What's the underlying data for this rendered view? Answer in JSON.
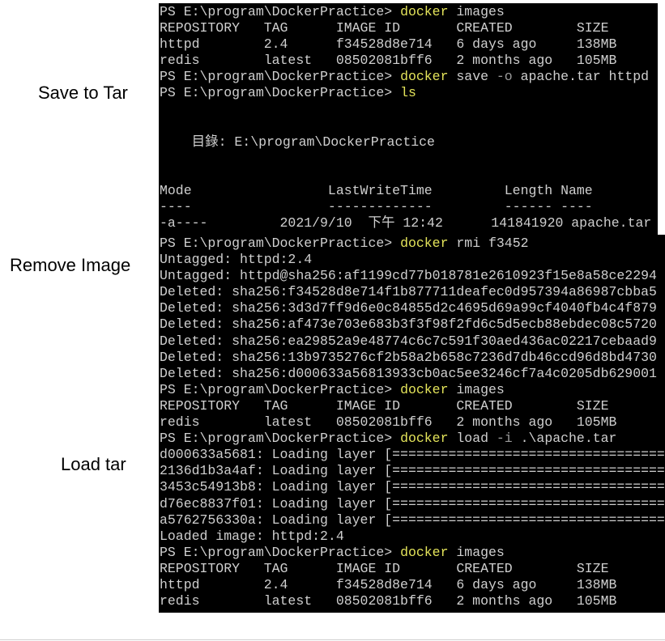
{
  "labels": {
    "save": "Save to Tar",
    "remove": "Remove Image",
    "load": "Load tar"
  },
  "colors": {
    "terminal_bg": "#000000",
    "text": "#cfcfcf",
    "command": "#e3e35a",
    "flag": "#9a9a9a"
  },
  "terminal1": {
    "lines": [
      {
        "segs": [
          {
            "t": "PS E:\\program\\DockerPractice> ",
            "c": "text"
          },
          {
            "t": "docker",
            "c": "cmd"
          },
          {
            "t": " images",
            "c": "text"
          }
        ]
      },
      {
        "segs": [
          {
            "t": "REPOSITORY   TAG      IMAGE ID       CREATED        SIZE",
            "c": "text"
          }
        ]
      },
      {
        "segs": [
          {
            "t": "httpd        2.4      f34528d8e714   6 days ago     138MB",
            "c": "text"
          }
        ]
      },
      {
        "segs": [
          {
            "t": "redis        latest   08502081bff6   2 months ago   105MB",
            "c": "text"
          }
        ]
      },
      {
        "segs": [
          {
            "t": "PS E:\\program\\DockerPractice> ",
            "c": "text"
          },
          {
            "t": "docker",
            "c": "cmd"
          },
          {
            "t": " save ",
            "c": "text"
          },
          {
            "t": "-o",
            "c": "flag"
          },
          {
            "t": " apache.tar httpd",
            "c": "text"
          }
        ]
      },
      {
        "segs": [
          {
            "t": "PS E:\\program\\DockerPractice> ",
            "c": "text"
          },
          {
            "t": "ls",
            "c": "cmd"
          }
        ]
      },
      {
        "segs": [
          {
            "t": "",
            "c": "text"
          }
        ]
      },
      {
        "segs": [
          {
            "t": "",
            "c": "text"
          }
        ]
      },
      {
        "segs": [
          {
            "t": "    目錄: E:\\program\\DockerPractice",
            "c": "text"
          }
        ]
      },
      {
        "segs": [
          {
            "t": "",
            "c": "text"
          }
        ]
      },
      {
        "segs": [
          {
            "t": "",
            "c": "text"
          }
        ]
      },
      {
        "segs": [
          {
            "t": "Mode                 LastWriteTime         Length Name",
            "c": "text"
          }
        ]
      },
      {
        "segs": [
          {
            "t": "----                 -------------         ------ ----",
            "c": "text"
          }
        ]
      },
      {
        "segs": [
          {
            "t": "-a----         2021/9/10  下午 12:42      141841920 apache.tar",
            "c": "text"
          }
        ]
      }
    ]
  },
  "terminal2": {
    "lines": [
      {
        "segs": [
          {
            "t": "PS E:\\program\\DockerPractice> ",
            "c": "text"
          },
          {
            "t": "docker",
            "c": "cmd"
          },
          {
            "t": " rmi f3452",
            "c": "text"
          }
        ]
      },
      {
        "segs": [
          {
            "t": "Untagged: httpd:2.4",
            "c": "text"
          }
        ]
      },
      {
        "segs": [
          {
            "t": "Untagged: httpd@sha256:af1199cd77b018781e2610923f15e8a58ce2294",
            "c": "text"
          }
        ]
      },
      {
        "segs": [
          {
            "t": "Deleted: sha256:f34528d8e714f1b877711deafec0d957394a86987cbba5",
            "c": "text"
          }
        ]
      },
      {
        "segs": [
          {
            "t": "Deleted: sha256:3d3d7ff9d6e0c84855d2c4695d69a99cf4040fb4c4f879",
            "c": "text"
          }
        ]
      },
      {
        "segs": [
          {
            "t": "Deleted: sha256:af473e703e683b3f3f98f2fd6c5d5ecb88ebdec08c5720",
            "c": "text"
          }
        ]
      },
      {
        "segs": [
          {
            "t": "Deleted: sha256:ea29852a9e48774c6c7c591f30aed436ac02217cebaad9",
            "c": "text"
          }
        ]
      },
      {
        "segs": [
          {
            "t": "Deleted: sha256:13b9735276cf2b58a2b658c7236d7db46ccd96d8bd4730",
            "c": "text"
          }
        ]
      },
      {
        "segs": [
          {
            "t": "Deleted: sha256:d000633a56813933cb0ac5ee3246cf7a4c0205db629001",
            "c": "text"
          }
        ]
      },
      {
        "segs": [
          {
            "t": "PS E:\\program\\DockerPractice> ",
            "c": "text"
          },
          {
            "t": "docker",
            "c": "cmd"
          },
          {
            "t": " images",
            "c": "text"
          }
        ]
      },
      {
        "segs": [
          {
            "t": "REPOSITORY   TAG      IMAGE ID       CREATED        SIZE",
            "c": "text"
          }
        ]
      },
      {
        "segs": [
          {
            "t": "redis        latest   08502081bff6   2 months ago   105MB",
            "c": "text"
          }
        ]
      },
      {
        "segs": [
          {
            "t": "PS E:\\program\\DockerPractice> ",
            "c": "text"
          },
          {
            "t": "docker",
            "c": "cmd"
          },
          {
            "t": " load ",
            "c": "text"
          },
          {
            "t": "-i",
            "c": "flag"
          },
          {
            "t": " .\\apache.tar",
            "c": "text"
          }
        ]
      },
      {
        "segs": [
          {
            "t": "d000633a5681: Loading layer [==================================",
            "c": "text"
          }
        ]
      },
      {
        "segs": [
          {
            "t": "2136d1b3a4af: Loading layer [==================================",
            "c": "text"
          }
        ]
      },
      {
        "segs": [
          {
            "t": "3453c54913b8: Loading layer [==================================",
            "c": "text"
          }
        ]
      },
      {
        "segs": [
          {
            "t": "d76ec8837f01: Loading layer [==================================",
            "c": "text"
          }
        ]
      },
      {
        "segs": [
          {
            "t": "a5762756330a: Loading layer [==================================",
            "c": "text"
          }
        ]
      },
      {
        "segs": [
          {
            "t": "Loaded image: httpd:2.4",
            "c": "text"
          }
        ]
      },
      {
        "segs": [
          {
            "t": "PS E:\\program\\DockerPractice> ",
            "c": "text"
          },
          {
            "t": "docker",
            "c": "cmd"
          },
          {
            "t": " images",
            "c": "text"
          }
        ]
      },
      {
        "segs": [
          {
            "t": "REPOSITORY   TAG      IMAGE ID       CREATED        SIZE",
            "c": "text"
          }
        ]
      },
      {
        "segs": [
          {
            "t": "httpd        2.4      f34528d8e714   6 days ago     138MB",
            "c": "text"
          }
        ]
      },
      {
        "segs": [
          {
            "t": "redis        latest   08502081bff6   2 months ago   105MB",
            "c": "text"
          }
        ]
      }
    ]
  }
}
